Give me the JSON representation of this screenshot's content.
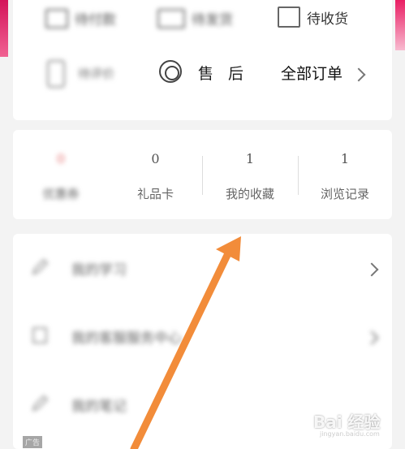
{
  "orders": {
    "status_items": [
      {
        "label": "待付款",
        "icon": "wallet-icon"
      },
      {
        "label": "待发货",
        "icon": "truck-icon"
      },
      {
        "label": "待收货",
        "icon": "package-icon"
      }
    ],
    "row2_blurred": [
      "待评价"
    ],
    "after_sale_label": "售后",
    "all_orders_label": "全部订单"
  },
  "stats": [
    {
      "num": "0",
      "label": "优惠券"
    },
    {
      "num": "0",
      "label": "礼品卡"
    },
    {
      "num": "1",
      "label": "我的收藏"
    },
    {
      "num": "1",
      "label": "浏览记录"
    }
  ],
  "menu": [
    {
      "label": "我的学习"
    },
    {
      "label": "我的客服服务中心"
    },
    {
      "label": "我的笔记"
    }
  ],
  "ad_label": "广告",
  "watermark": {
    "text": "Bai 经验",
    "url": "jingyan.baidu.com"
  },
  "colors": {
    "accent_pink": "#e91e63",
    "arrow": "#f28c3a"
  }
}
